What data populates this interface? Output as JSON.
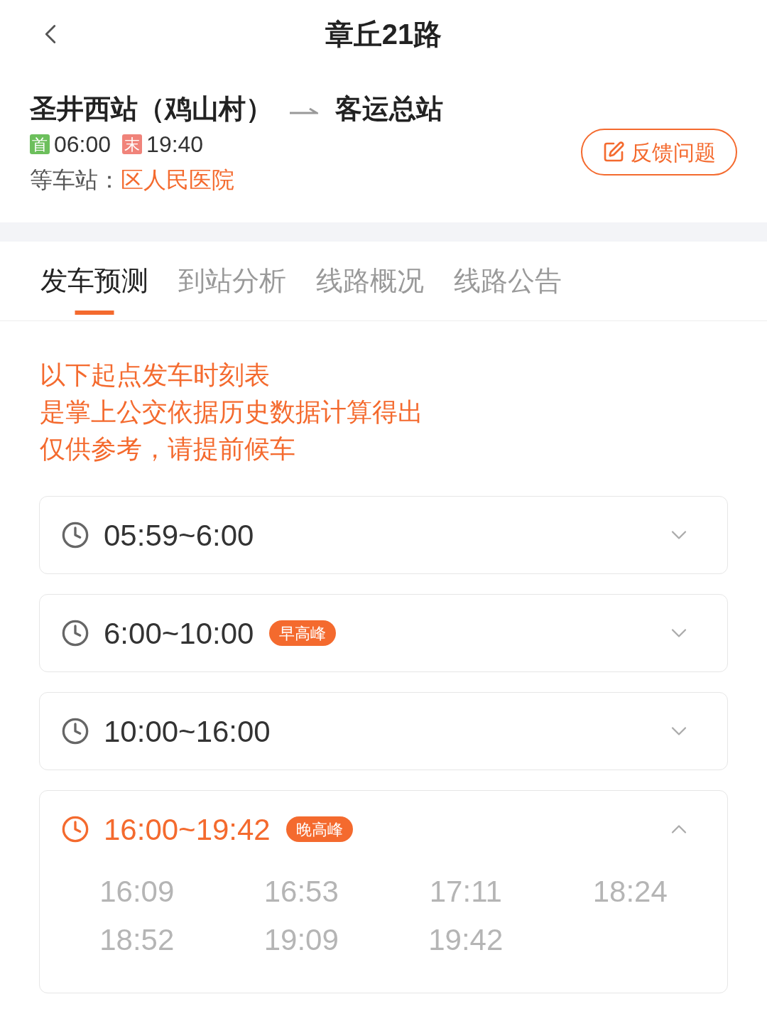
{
  "header": {
    "title": "章丘21路"
  },
  "route": {
    "from": "圣井西站（鸡山村）",
    "to": "客运总站",
    "first_label": "首",
    "first_time": "06:00",
    "last_label": "末",
    "last_time": "19:40",
    "wait_label": "等车站：",
    "wait_station": "区人民医院",
    "feedback_button": "反馈问题"
  },
  "tabs": [
    {
      "label": "发车预测",
      "selected": true
    },
    {
      "label": "到站分析",
      "selected": false
    },
    {
      "label": "线路概况",
      "selected": false
    },
    {
      "label": "线路公告",
      "selected": false
    }
  ],
  "notice": [
    "以下起点发车时刻表",
    "是掌上公交依据历史数据计算得出",
    "仅供参考，请提前候车"
  ],
  "periods": [
    {
      "range": "05:59~6:00",
      "expanded": false
    },
    {
      "range": "6:00~10:00",
      "badge": "早高峰",
      "expanded": false
    },
    {
      "range": "10:00~16:00",
      "expanded": false
    },
    {
      "range": "16:00~19:42",
      "badge": "晚高峰",
      "expanded": true,
      "times": [
        "16:09",
        "16:53",
        "17:11",
        "18:24",
        "18:52",
        "19:09",
        "19:42"
      ]
    }
  ]
}
